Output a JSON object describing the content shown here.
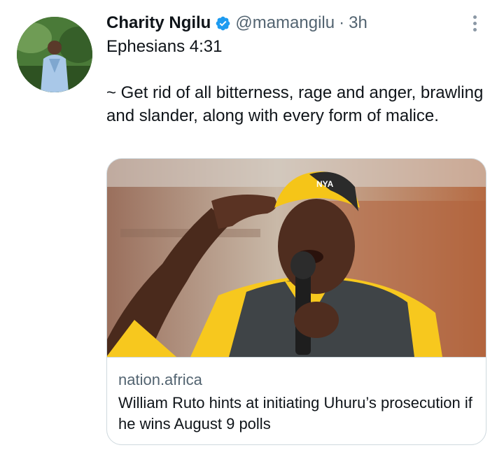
{
  "tweet": {
    "author_name": "Charity Ngilu",
    "handle": "@mamangilu",
    "separator": "·",
    "time": "3h",
    "text_lines": [
      "Ephesians 4:31",
      "~ Get rid of all bitterness, rage and anger, brawling and slander, along with every form of malice."
    ]
  },
  "card": {
    "domain": "nation.africa",
    "title": "William Ruto hints at initiating Uhuru’s prosecution if he wins August 9 polls",
    "cap_text": "NYA"
  },
  "icons": {
    "verified": "verified-badge-icon",
    "more": "more-options-icon"
  },
  "colors": {
    "verified_blue": "#1d9bf0",
    "secondary_text": "#536471",
    "border": "#cfd9de",
    "cap_yellow": "#f5c518",
    "shirt_yellow": "#f7c81e"
  }
}
